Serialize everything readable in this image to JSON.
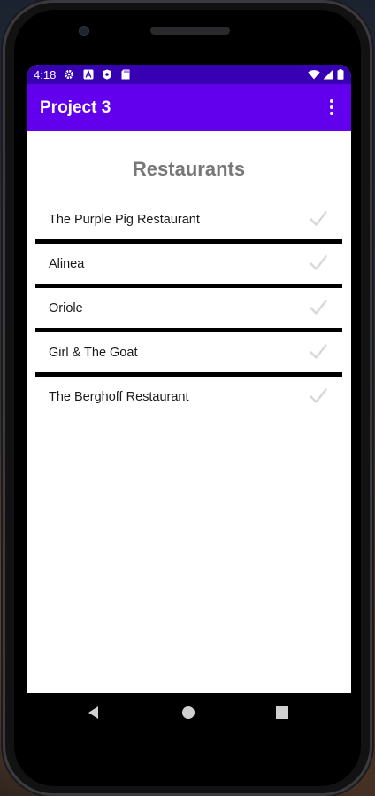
{
  "status_bar": {
    "time": "4:18",
    "left_icons": [
      "gear-icon",
      "a-icon",
      "shield-icon",
      "sd-card-icon"
    ],
    "right_icons": [
      "wifi-icon",
      "signal-icon",
      "battery-icon"
    ]
  },
  "app_bar": {
    "title": "Project 3",
    "menu_icon": "overflow-menu-icon"
  },
  "main": {
    "heading": "Restaurants",
    "items": [
      {
        "label": "The Purple Pig Restaurant",
        "checked": false
      },
      {
        "label": "Alinea",
        "checked": false
      },
      {
        "label": "Oriole",
        "checked": false
      },
      {
        "label": "Girl & The Goat",
        "checked": false
      },
      {
        "label": "The Berghoff Restaurant",
        "checked": false
      }
    ]
  },
  "nav_bar": {
    "buttons": [
      "back-icon",
      "home-icon",
      "recents-icon"
    ]
  },
  "colors": {
    "status_bar": "#3700b3",
    "app_bar": "#6200ee",
    "heading": "#777777",
    "divider": "#000000",
    "check_unchecked": "#d8d8d8"
  }
}
